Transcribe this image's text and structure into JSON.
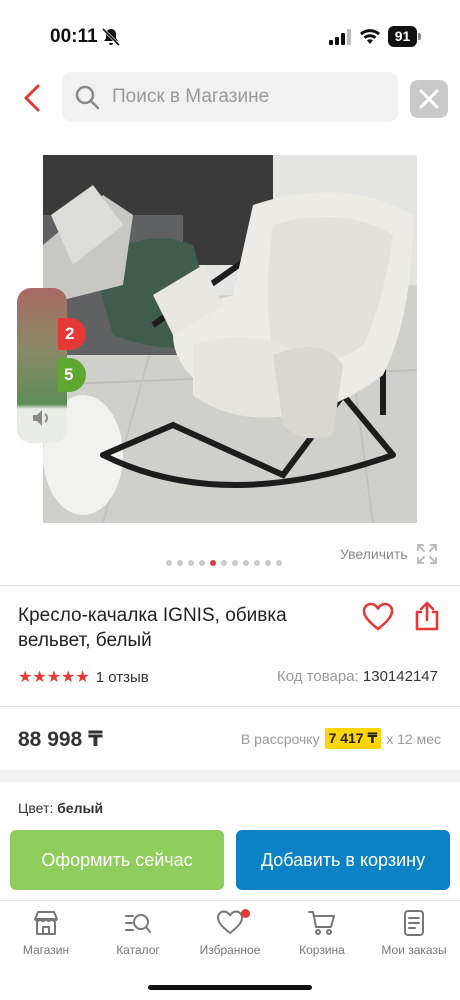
{
  "status_bar": {
    "time": "00:11",
    "battery": "91"
  },
  "search": {
    "placeholder": "Поиск в Магазине"
  },
  "gallery": {
    "image_count": 11,
    "active_index": 4,
    "zoom_label": "Увеличить"
  },
  "overlay": {
    "badge_red": "2",
    "badge_green": "5"
  },
  "product": {
    "title": "Кресло-качалка IGNIS, обивка вельвет, белый",
    "rating_stars": "★★★★★",
    "reviews": "1 отзыв",
    "code_label": "Код товара:",
    "code": "130142147",
    "price": "88 998 ₸",
    "installment_label": "В рассрочку",
    "installment_amount": "7 417 ₸",
    "installment_term": "x 12 мес",
    "color_label": "Цвет:",
    "color_value": "белый"
  },
  "actions": {
    "checkout": "Оформить сейчас",
    "add_to_cart": "Добавить в корзину"
  },
  "tabbar": {
    "items": [
      {
        "label": "Магазин",
        "icon": "store-icon"
      },
      {
        "label": "Каталог",
        "icon": "catalog-search-icon"
      },
      {
        "label": "Избранное",
        "icon": "heart-icon"
      },
      {
        "label": "Корзина",
        "icon": "cart-icon"
      },
      {
        "label": "Мои заказы",
        "icon": "orders-icon"
      }
    ]
  },
  "colors": {
    "accent_red": "#e53935",
    "checkout_green": "#8fce5c",
    "cart_blue": "#0b82c5",
    "installment_yellow": "#ffd400"
  }
}
